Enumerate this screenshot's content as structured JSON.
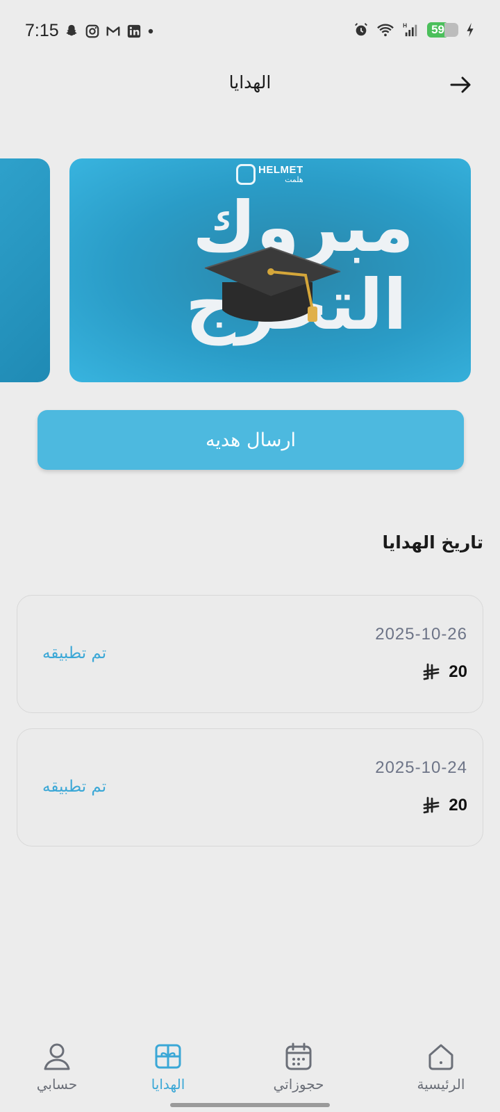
{
  "status_bar": {
    "time": "7:15",
    "battery": "59",
    "left_icons": [
      "snapchat-icon",
      "instagram-icon",
      "gmail-icon",
      "linkedin-icon",
      "dot-icon"
    ],
    "right_icons": [
      "alarm-icon",
      "wifi-icon",
      "signal-icon",
      "battery-icon",
      "charging-icon"
    ]
  },
  "header": {
    "title": "الهدايا",
    "back_icon": "arrow-right-icon"
  },
  "banner": {
    "logo_text": "HELMET",
    "logo_sub": "هلمت",
    "line1": "مبروك",
    "line2": "التخرج"
  },
  "send_gift_button": "ارسال هديه",
  "history": {
    "title": "تاريخ الهدايا",
    "items": [
      {
        "date": "2025-10-26",
        "amount": "20",
        "currency_icon": "saudi-riyal-icon",
        "status": "تم تطبيقه"
      },
      {
        "date": "2025-10-24",
        "amount": "20",
        "currency_icon": "saudi-riyal-icon",
        "status": "تم تطبيقه"
      }
    ]
  },
  "bottom_nav": {
    "account": "حسابي",
    "gifts": "الهدايا",
    "bookings": "حجوزاتي",
    "home": "الرئيسية",
    "active": "gifts"
  },
  "colors": {
    "accent": "#4db9df",
    "status_text": "#3aa7d6",
    "background": "#ececec"
  }
}
